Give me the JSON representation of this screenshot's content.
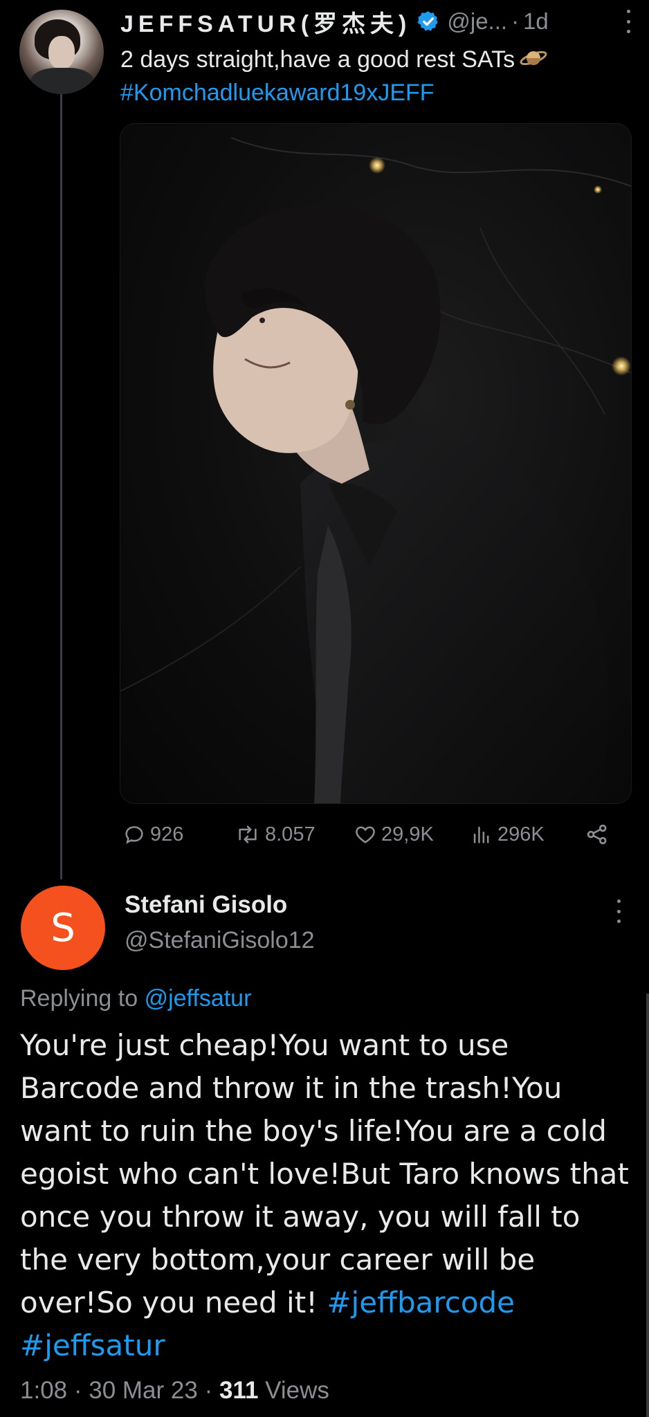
{
  "original_tweet": {
    "display_name": "JEFFSATUR(罗杰夫)",
    "handle": "@je...",
    "time": "1d",
    "text": "2 days straight,have a good rest SATs",
    "hashtag": "#Komchadluekaward19xJEFF",
    "stats": {
      "replies": "926",
      "retweets": "8.057",
      "likes": "29,9K",
      "views": "296K"
    }
  },
  "reply": {
    "avatar_letter": "S",
    "avatar_color": "#f4511e",
    "display_name": "Stefani Gisolo",
    "handle": "@StefaniGisolo12",
    "replying_prefix": "Replying to",
    "replying_to": "@jeffsatur",
    "body": "You're just cheap!You want to use Barcode and throw it in the trash!You want to ruin the boy's life!You are a cold egoist who can't love!But Taro knows that once you throw it away, you will fall to the very bottom,your career will be over!So  you need it! ",
    "hashtag_1": "#jeffbarcode",
    "hashtag_2": "#jeffsatur",
    "time": "1:08",
    "date": "30 Mar 23",
    "views_count": "311",
    "views_label": "Views"
  },
  "colors": {
    "background": "#000000",
    "link": "#1d9bf0",
    "muted": "#8b8f94",
    "text": "#e7e9ea"
  }
}
